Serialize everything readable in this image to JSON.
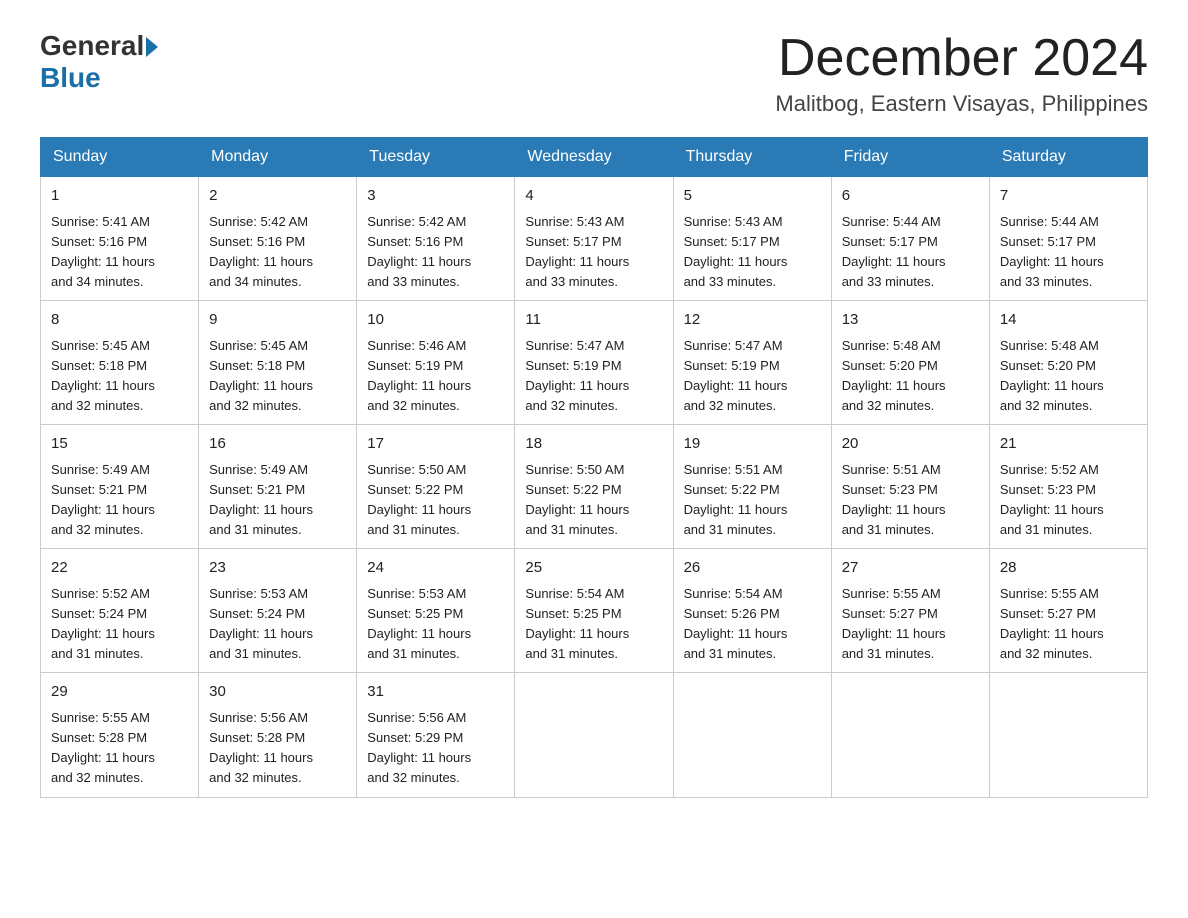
{
  "header": {
    "logo_general": "General",
    "logo_blue": "Blue",
    "month_title": "December 2024",
    "location": "Malitbog, Eastern Visayas, Philippines"
  },
  "weekdays": [
    "Sunday",
    "Monday",
    "Tuesday",
    "Wednesday",
    "Thursday",
    "Friday",
    "Saturday"
  ],
  "weeks": [
    [
      {
        "day": "1",
        "sunrise": "5:41 AM",
        "sunset": "5:16 PM",
        "daylight": "11 hours and 34 minutes."
      },
      {
        "day": "2",
        "sunrise": "5:42 AM",
        "sunset": "5:16 PM",
        "daylight": "11 hours and 34 minutes."
      },
      {
        "day": "3",
        "sunrise": "5:42 AM",
        "sunset": "5:16 PM",
        "daylight": "11 hours and 33 minutes."
      },
      {
        "day": "4",
        "sunrise": "5:43 AM",
        "sunset": "5:17 PM",
        "daylight": "11 hours and 33 minutes."
      },
      {
        "day": "5",
        "sunrise": "5:43 AM",
        "sunset": "5:17 PM",
        "daylight": "11 hours and 33 minutes."
      },
      {
        "day": "6",
        "sunrise": "5:44 AM",
        "sunset": "5:17 PM",
        "daylight": "11 hours and 33 minutes."
      },
      {
        "day": "7",
        "sunrise": "5:44 AM",
        "sunset": "5:17 PM",
        "daylight": "11 hours and 33 minutes."
      }
    ],
    [
      {
        "day": "8",
        "sunrise": "5:45 AM",
        "sunset": "5:18 PM",
        "daylight": "11 hours and 32 minutes."
      },
      {
        "day": "9",
        "sunrise": "5:45 AM",
        "sunset": "5:18 PM",
        "daylight": "11 hours and 32 minutes."
      },
      {
        "day": "10",
        "sunrise": "5:46 AM",
        "sunset": "5:19 PM",
        "daylight": "11 hours and 32 minutes."
      },
      {
        "day": "11",
        "sunrise": "5:47 AM",
        "sunset": "5:19 PM",
        "daylight": "11 hours and 32 minutes."
      },
      {
        "day": "12",
        "sunrise": "5:47 AM",
        "sunset": "5:19 PM",
        "daylight": "11 hours and 32 minutes."
      },
      {
        "day": "13",
        "sunrise": "5:48 AM",
        "sunset": "5:20 PM",
        "daylight": "11 hours and 32 minutes."
      },
      {
        "day": "14",
        "sunrise": "5:48 AM",
        "sunset": "5:20 PM",
        "daylight": "11 hours and 32 minutes."
      }
    ],
    [
      {
        "day": "15",
        "sunrise": "5:49 AM",
        "sunset": "5:21 PM",
        "daylight": "11 hours and 32 minutes."
      },
      {
        "day": "16",
        "sunrise": "5:49 AM",
        "sunset": "5:21 PM",
        "daylight": "11 hours and 31 minutes."
      },
      {
        "day": "17",
        "sunrise": "5:50 AM",
        "sunset": "5:22 PM",
        "daylight": "11 hours and 31 minutes."
      },
      {
        "day": "18",
        "sunrise": "5:50 AM",
        "sunset": "5:22 PM",
        "daylight": "11 hours and 31 minutes."
      },
      {
        "day": "19",
        "sunrise": "5:51 AM",
        "sunset": "5:22 PM",
        "daylight": "11 hours and 31 minutes."
      },
      {
        "day": "20",
        "sunrise": "5:51 AM",
        "sunset": "5:23 PM",
        "daylight": "11 hours and 31 minutes."
      },
      {
        "day": "21",
        "sunrise": "5:52 AM",
        "sunset": "5:23 PM",
        "daylight": "11 hours and 31 minutes."
      }
    ],
    [
      {
        "day": "22",
        "sunrise": "5:52 AM",
        "sunset": "5:24 PM",
        "daylight": "11 hours and 31 minutes."
      },
      {
        "day": "23",
        "sunrise": "5:53 AM",
        "sunset": "5:24 PM",
        "daylight": "11 hours and 31 minutes."
      },
      {
        "day": "24",
        "sunrise": "5:53 AM",
        "sunset": "5:25 PM",
        "daylight": "11 hours and 31 minutes."
      },
      {
        "day": "25",
        "sunrise": "5:54 AM",
        "sunset": "5:25 PM",
        "daylight": "11 hours and 31 minutes."
      },
      {
        "day": "26",
        "sunrise": "5:54 AM",
        "sunset": "5:26 PM",
        "daylight": "11 hours and 31 minutes."
      },
      {
        "day": "27",
        "sunrise": "5:55 AM",
        "sunset": "5:27 PM",
        "daylight": "11 hours and 31 minutes."
      },
      {
        "day": "28",
        "sunrise": "5:55 AM",
        "sunset": "5:27 PM",
        "daylight": "11 hours and 32 minutes."
      }
    ],
    [
      {
        "day": "29",
        "sunrise": "5:55 AM",
        "sunset": "5:28 PM",
        "daylight": "11 hours and 32 minutes."
      },
      {
        "day": "30",
        "sunrise": "5:56 AM",
        "sunset": "5:28 PM",
        "daylight": "11 hours and 32 minutes."
      },
      {
        "day": "31",
        "sunrise": "5:56 AM",
        "sunset": "5:29 PM",
        "daylight": "11 hours and 32 minutes."
      },
      null,
      null,
      null,
      null
    ]
  ],
  "labels": {
    "sunrise": "Sunrise:",
    "sunset": "Sunset:",
    "daylight": "Daylight:"
  }
}
